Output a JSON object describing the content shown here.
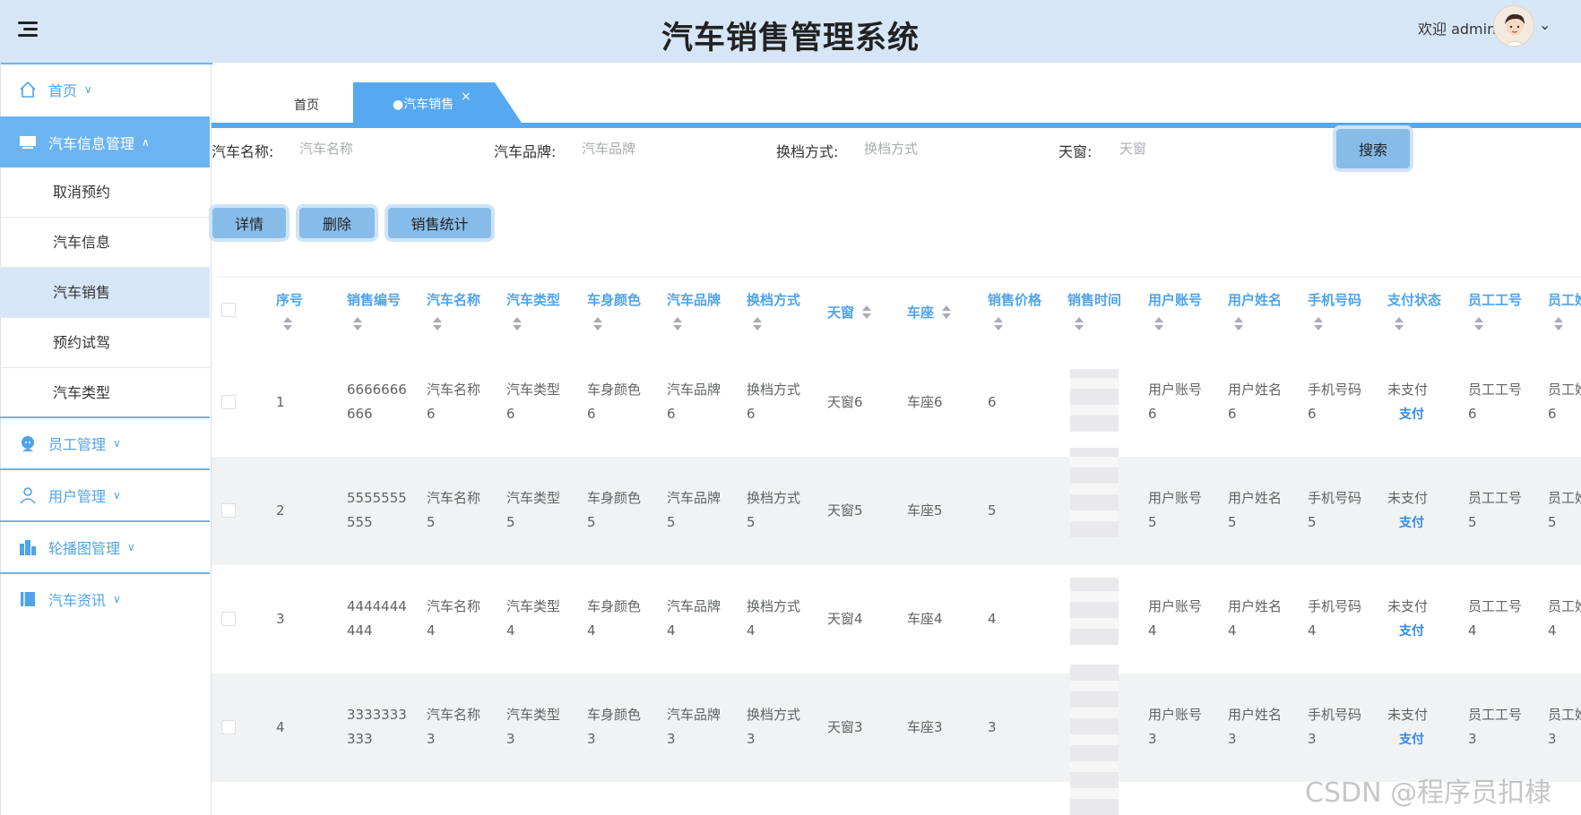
{
  "header": {
    "title": "汽车销售管理系统",
    "welcome": "欢迎 admin"
  },
  "sidebar": {
    "items": [
      {
        "label": "首页",
        "icon": "home-icon"
      },
      {
        "label": "汽车信息管理",
        "icon": "monitor-icon"
      },
      {
        "label": "员工管理",
        "icon": "staff-icon"
      },
      {
        "label": "用户管理",
        "icon": "user-icon"
      },
      {
        "label": "轮播图管理",
        "icon": "building-icon"
      },
      {
        "label": "汽车资讯",
        "icon": "book-icon"
      }
    ],
    "submenu": [
      "取消预约",
      "汽车信息",
      "汽车销售",
      "预约试驾",
      "汽车类型"
    ]
  },
  "tabs": {
    "home": "首页",
    "active": "●汽车销售",
    "close": "×"
  },
  "search": {
    "fields": [
      {
        "label": "汽车名称:",
        "placeholder": "汽车名称"
      },
      {
        "label": "汽车品牌:",
        "placeholder": "汽车品牌"
      },
      {
        "label": "换档方式:",
        "placeholder": "换档方式"
      },
      {
        "label": "天窗:",
        "placeholder": "天窗"
      }
    ],
    "button": "搜索"
  },
  "actions": {
    "detail": "详情",
    "delete": "删除",
    "stats": "销售统计"
  },
  "table": {
    "headers": [
      "序号",
      "销售编号",
      "汽车名称",
      "汽车类型",
      "车身颜色",
      "汽车品牌",
      "换档方式",
      "天窗",
      "车座",
      "销售价格",
      "销售时间",
      "用户账号",
      "用户姓名",
      "手机号码",
      "支付状态",
      "员工工号",
      "员工姓"
    ],
    "rows": [
      {
        "idx": "1",
        "code": [
          "6666666",
          "666"
        ],
        "name": [
          "汽车名称",
          "6"
        ],
        "type": [
          "汽车类型",
          "6"
        ],
        "color": [
          "车身颜色",
          "6"
        ],
        "brand": [
          "汽车品牌",
          "6"
        ],
        "shift": [
          "换档方式",
          "6"
        ],
        "sunroof": "天窗6",
        "seat": "车座6",
        "price": "6",
        "account": [
          "用户账号",
          "6"
        ],
        "uname": [
          "用户姓名",
          "6"
        ],
        "phone": [
          "手机号码",
          "6"
        ],
        "pay_status": "未支付",
        "pay_link": "支付",
        "staff_no": [
          "员工工号",
          "6"
        ],
        "staff_name": [
          "员工姓",
          "6"
        ]
      },
      {
        "idx": "2",
        "code": [
          "5555555",
          "555"
        ],
        "name": [
          "汽车名称",
          "5"
        ],
        "type": [
          "汽车类型",
          "5"
        ],
        "color": [
          "车身颜色",
          "5"
        ],
        "brand": [
          "汽车品牌",
          "5"
        ],
        "shift": [
          "换档方式",
          "5"
        ],
        "sunroof": "天窗5",
        "seat": "车座5",
        "price": "5",
        "account": [
          "用户账号",
          "5"
        ],
        "uname": [
          "用户姓名",
          "5"
        ],
        "phone": [
          "手机号码",
          "5"
        ],
        "pay_status": "未支付",
        "pay_link": "支付",
        "staff_no": [
          "员工工号",
          "5"
        ],
        "staff_name": [
          "员工姓",
          "5"
        ]
      },
      {
        "idx": "3",
        "code": [
          "4444444",
          "444"
        ],
        "name": [
          "汽车名称",
          "4"
        ],
        "type": [
          "汽车类型",
          "4"
        ],
        "color": [
          "车身颜色",
          "4"
        ],
        "brand": [
          "汽车品牌",
          "4"
        ],
        "shift": [
          "换档方式",
          "4"
        ],
        "sunroof": "天窗4",
        "seat": "车座4",
        "price": "4",
        "account": [
          "用户账号",
          "4"
        ],
        "uname": [
          "用户姓名",
          "4"
        ],
        "phone": [
          "手机号码",
          "4"
        ],
        "pay_status": "未支付",
        "pay_link": "支付",
        "staff_no": [
          "员工工号",
          "4"
        ],
        "staff_name": [
          "员工姓",
          "4"
        ]
      },
      {
        "idx": "4",
        "code": [
          "3333333",
          "333"
        ],
        "name": [
          "汽车名称",
          "3"
        ],
        "type": [
          "汽车类型",
          "3"
        ],
        "color": [
          "车身颜色",
          "3"
        ],
        "brand": [
          "汽车品牌",
          "3"
        ],
        "shift": [
          "换档方式",
          "3"
        ],
        "sunroof": "天窗3",
        "seat": "车座3",
        "price": "3",
        "account": [
          "用户账号",
          "3"
        ],
        "uname": [
          "用户姓名",
          "3"
        ],
        "phone": [
          "手机号码",
          "3"
        ],
        "pay_status": "未支付",
        "pay_link": "支付",
        "staff_no": [
          "员工工号",
          "3"
        ],
        "staff_name": [
          "员工姓",
          "3"
        ]
      }
    ]
  },
  "watermark": "CSDN @程序员扣棣",
  "colors": {
    "accent": "#4fa3eb",
    "header_bg": "#d6e6f7",
    "active_bg": "#6cb4f1",
    "button_bg": "#88bce8",
    "stripe": "#f1f2f4"
  }
}
